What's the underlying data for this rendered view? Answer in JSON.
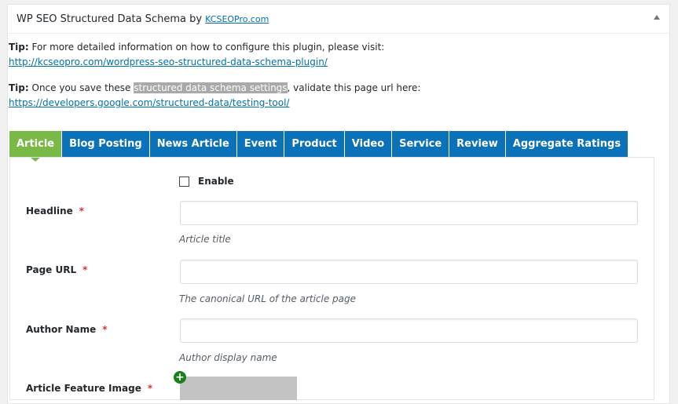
{
  "panel": {
    "title": "WP SEO Structured Data Schema by ",
    "brand_link": "KCSEOPro.com"
  },
  "tips": [
    {
      "label": "Tip:",
      "text": " For more detailed information on how to configure this plugin, please visit:",
      "link": "http://kcseopro.com/wordpress-seo-structured-data-schema-plugin/"
    },
    {
      "label": "Tip:",
      "text_before": " Once you save these ",
      "highlight": "structured data schema settings",
      "text_after": ", validate this page url here:",
      "link": "https://developers.google.com/structured-data/testing-tool/"
    }
  ],
  "tabs": [
    {
      "label": "Article",
      "active": true
    },
    {
      "label": "Blog Posting"
    },
    {
      "label": "News Article"
    },
    {
      "label": "Event"
    },
    {
      "label": "Product"
    },
    {
      "label": "Video"
    },
    {
      "label": "Service"
    },
    {
      "label": "Review"
    },
    {
      "label": "Aggregate Ratings"
    }
  ],
  "form": {
    "enable_label": "Enable",
    "enable_checked": false,
    "fields": [
      {
        "label": "Headline",
        "required": "*",
        "value": "",
        "hint": "Article title"
      },
      {
        "label": "Page URL",
        "required": "*",
        "value": "",
        "hint": "The canonical URL of the article page"
      },
      {
        "label": "Author Name",
        "required": "*",
        "value": "",
        "hint": "Author display name"
      },
      {
        "label": "Article Feature Image",
        "required": "*"
      }
    ]
  },
  "colors": {
    "tab": "#0b71b9",
    "tab_active": "#7ab948",
    "link": "#0073aa",
    "required": "#dc3232"
  }
}
